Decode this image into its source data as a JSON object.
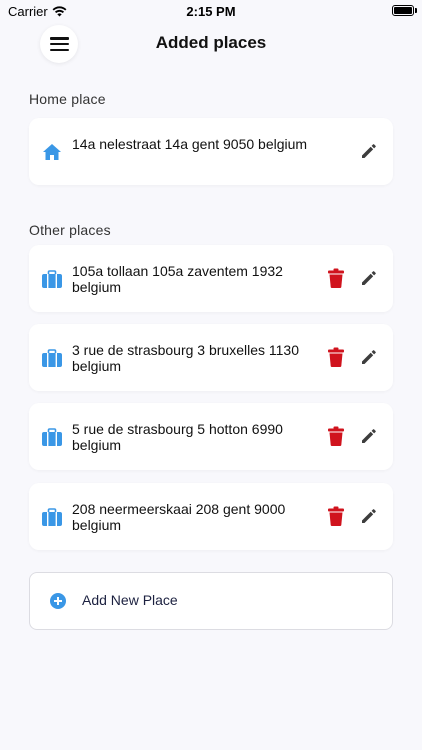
{
  "status_bar": {
    "carrier": "Carrier",
    "time": "2:15 PM"
  },
  "header": {
    "title": "Added places"
  },
  "home_section": {
    "label": "Home place",
    "place": {
      "address": "14a nelestraat 14a gent 9050 belgium",
      "icon": "home-icon"
    }
  },
  "other_section": {
    "label": "Other places",
    "places": [
      {
        "address": "105a tollaan 105a zaventem 1932 belgium",
        "icon": "briefcase-icon"
      },
      {
        "address": "3 rue de strasbourg 3 bruxelles 1130 belgium",
        "icon": "briefcase-icon"
      },
      {
        "address": "5 rue de strasbourg 5 hotton 6990 belgium",
        "icon": "briefcase-icon"
      },
      {
        "address": "208 neermeerskaai 208 gent 9000 belgium",
        "icon": "briefcase-icon"
      }
    ]
  },
  "add_place": {
    "label": "Add New Place",
    "icon": "plus-circle-icon"
  },
  "colors": {
    "background": "#f8f8fc",
    "accent_blue": "#3a97e6",
    "delete_red": "#d0131d",
    "edit_gray": "#3d3d3d"
  }
}
